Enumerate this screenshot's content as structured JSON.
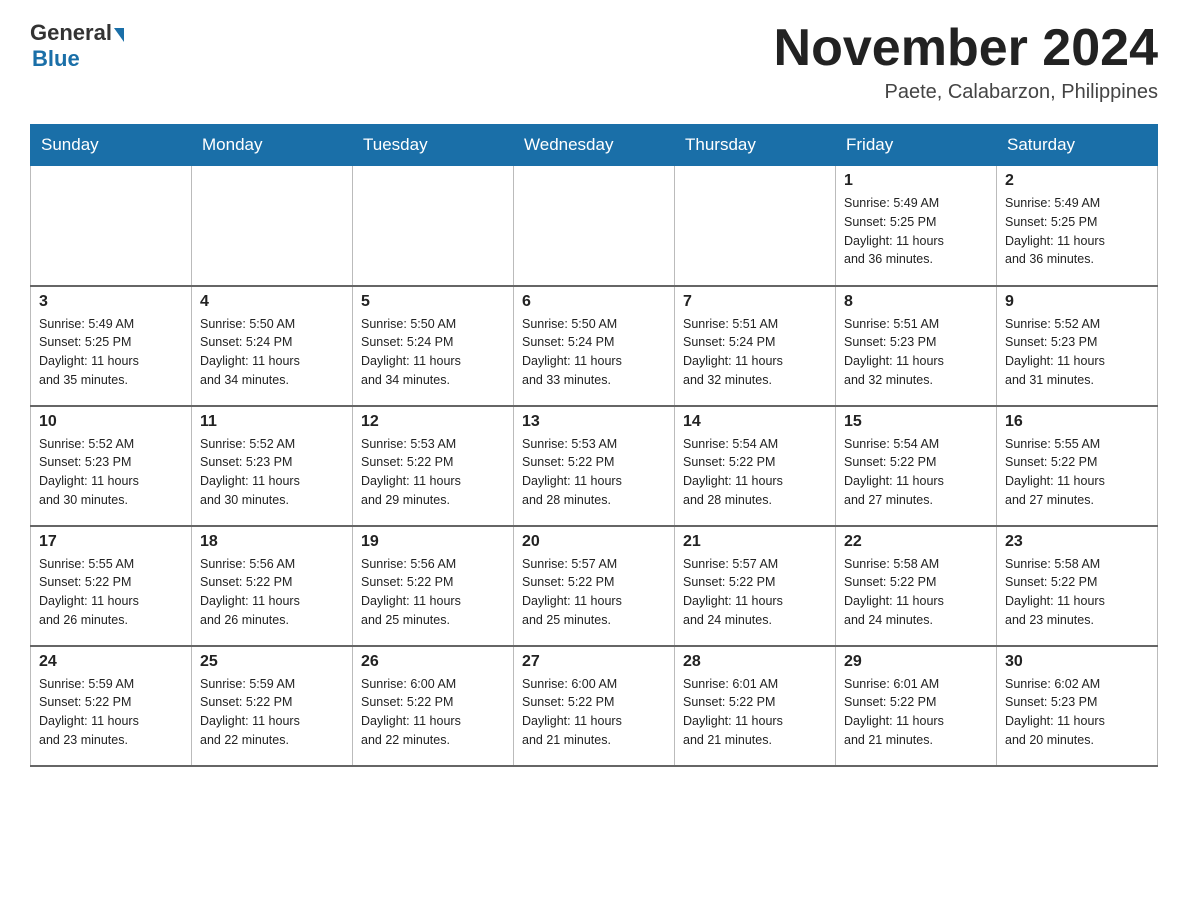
{
  "logo": {
    "general": "General",
    "blue": "Blue"
  },
  "title": "November 2024",
  "location": "Paete, Calabarzon, Philippines",
  "days_of_week": [
    "Sunday",
    "Monday",
    "Tuesday",
    "Wednesday",
    "Thursday",
    "Friday",
    "Saturday"
  ],
  "weeks": [
    [
      {
        "day": "",
        "info": ""
      },
      {
        "day": "",
        "info": ""
      },
      {
        "day": "",
        "info": ""
      },
      {
        "day": "",
        "info": ""
      },
      {
        "day": "",
        "info": ""
      },
      {
        "day": "1",
        "info": "Sunrise: 5:49 AM\nSunset: 5:25 PM\nDaylight: 11 hours\nand 36 minutes."
      },
      {
        "day": "2",
        "info": "Sunrise: 5:49 AM\nSunset: 5:25 PM\nDaylight: 11 hours\nand 36 minutes."
      }
    ],
    [
      {
        "day": "3",
        "info": "Sunrise: 5:49 AM\nSunset: 5:25 PM\nDaylight: 11 hours\nand 35 minutes."
      },
      {
        "day": "4",
        "info": "Sunrise: 5:50 AM\nSunset: 5:24 PM\nDaylight: 11 hours\nand 34 minutes."
      },
      {
        "day": "5",
        "info": "Sunrise: 5:50 AM\nSunset: 5:24 PM\nDaylight: 11 hours\nand 34 minutes."
      },
      {
        "day": "6",
        "info": "Sunrise: 5:50 AM\nSunset: 5:24 PM\nDaylight: 11 hours\nand 33 minutes."
      },
      {
        "day": "7",
        "info": "Sunrise: 5:51 AM\nSunset: 5:24 PM\nDaylight: 11 hours\nand 32 minutes."
      },
      {
        "day": "8",
        "info": "Sunrise: 5:51 AM\nSunset: 5:23 PM\nDaylight: 11 hours\nand 32 minutes."
      },
      {
        "day": "9",
        "info": "Sunrise: 5:52 AM\nSunset: 5:23 PM\nDaylight: 11 hours\nand 31 minutes."
      }
    ],
    [
      {
        "day": "10",
        "info": "Sunrise: 5:52 AM\nSunset: 5:23 PM\nDaylight: 11 hours\nand 30 minutes."
      },
      {
        "day": "11",
        "info": "Sunrise: 5:52 AM\nSunset: 5:23 PM\nDaylight: 11 hours\nand 30 minutes."
      },
      {
        "day": "12",
        "info": "Sunrise: 5:53 AM\nSunset: 5:22 PM\nDaylight: 11 hours\nand 29 minutes."
      },
      {
        "day": "13",
        "info": "Sunrise: 5:53 AM\nSunset: 5:22 PM\nDaylight: 11 hours\nand 28 minutes."
      },
      {
        "day": "14",
        "info": "Sunrise: 5:54 AM\nSunset: 5:22 PM\nDaylight: 11 hours\nand 28 minutes."
      },
      {
        "day": "15",
        "info": "Sunrise: 5:54 AM\nSunset: 5:22 PM\nDaylight: 11 hours\nand 27 minutes."
      },
      {
        "day": "16",
        "info": "Sunrise: 5:55 AM\nSunset: 5:22 PM\nDaylight: 11 hours\nand 27 minutes."
      }
    ],
    [
      {
        "day": "17",
        "info": "Sunrise: 5:55 AM\nSunset: 5:22 PM\nDaylight: 11 hours\nand 26 minutes."
      },
      {
        "day": "18",
        "info": "Sunrise: 5:56 AM\nSunset: 5:22 PM\nDaylight: 11 hours\nand 26 minutes."
      },
      {
        "day": "19",
        "info": "Sunrise: 5:56 AM\nSunset: 5:22 PM\nDaylight: 11 hours\nand 25 minutes."
      },
      {
        "day": "20",
        "info": "Sunrise: 5:57 AM\nSunset: 5:22 PM\nDaylight: 11 hours\nand 25 minutes."
      },
      {
        "day": "21",
        "info": "Sunrise: 5:57 AM\nSunset: 5:22 PM\nDaylight: 11 hours\nand 24 minutes."
      },
      {
        "day": "22",
        "info": "Sunrise: 5:58 AM\nSunset: 5:22 PM\nDaylight: 11 hours\nand 24 minutes."
      },
      {
        "day": "23",
        "info": "Sunrise: 5:58 AM\nSunset: 5:22 PM\nDaylight: 11 hours\nand 23 minutes."
      }
    ],
    [
      {
        "day": "24",
        "info": "Sunrise: 5:59 AM\nSunset: 5:22 PM\nDaylight: 11 hours\nand 23 minutes."
      },
      {
        "day": "25",
        "info": "Sunrise: 5:59 AM\nSunset: 5:22 PM\nDaylight: 11 hours\nand 22 minutes."
      },
      {
        "day": "26",
        "info": "Sunrise: 6:00 AM\nSunset: 5:22 PM\nDaylight: 11 hours\nand 22 minutes."
      },
      {
        "day": "27",
        "info": "Sunrise: 6:00 AM\nSunset: 5:22 PM\nDaylight: 11 hours\nand 21 minutes."
      },
      {
        "day": "28",
        "info": "Sunrise: 6:01 AM\nSunset: 5:22 PM\nDaylight: 11 hours\nand 21 minutes."
      },
      {
        "day": "29",
        "info": "Sunrise: 6:01 AM\nSunset: 5:22 PM\nDaylight: 11 hours\nand 21 minutes."
      },
      {
        "day": "30",
        "info": "Sunrise: 6:02 AM\nSunset: 5:23 PM\nDaylight: 11 hours\nand 20 minutes."
      }
    ]
  ]
}
